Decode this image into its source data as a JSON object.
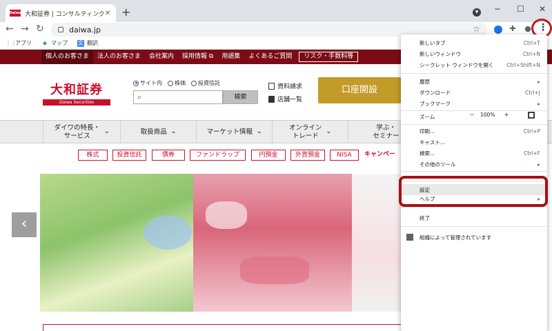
{
  "browser": {
    "tab_title": "大和証券 | コンサルティングとネット取",
    "favicon_text": "Daiwa",
    "tab_close": "✕",
    "new_tab": "+",
    "url": "daiwa.jp",
    "win_min": "−",
    "win_max": "☐",
    "win_close": "✕",
    "bookmarks": [
      {
        "label": "アプリ"
      },
      {
        "label": "マップ"
      },
      {
        "label": "翻訳"
      }
    ]
  },
  "site": {
    "top_nav": [
      "個人のお客さま",
      "法人のお客さま",
      "会社案内",
      "採用情報 ⧉",
      "用語集",
      "よくあるご質問",
      "リスク・手数料等"
    ],
    "logo": {
      "main": "大和証券",
      "sub": "Daiwa Securities"
    },
    "search": {
      "radios": [
        "サイト内",
        "株価",
        "投資信託"
      ],
      "button": "検索"
    },
    "links": [
      "資料請求",
      "店舗一覧"
    ],
    "open_account": "口座開設",
    "main_nav": [
      {
        "line1": "ダイワの特長・",
        "line2": "サービス"
      },
      {
        "line1": "取扱商品",
        "line2": ""
      },
      {
        "line1": "マーケット情報",
        "line2": ""
      },
      {
        "line1": "オンライン",
        "line2": "トレード"
      },
      {
        "line1": "学ぶ・",
        "line2": "セミナー"
      }
    ],
    "categories": [
      "株式",
      "投資信託",
      "債券",
      "ファンドラップ",
      "円預金",
      "外貨預金",
      "NISA",
      "キャンペー"
    ],
    "carousel_prev": "‹",
    "carousel_next": "›"
  },
  "chrome_menu": {
    "items": [
      {
        "label": "新しいタブ",
        "shortcut": "Ctrl+T"
      },
      {
        "label": "新しいウィンドウ",
        "shortcut": "Ctrl+N"
      },
      {
        "label": "シークレット ウィンドウを開く",
        "shortcut": "Ctrl+Shift+N"
      },
      {
        "label": "履歴",
        "shortcut": "▸"
      },
      {
        "label": "ダウンロード",
        "shortcut": "Ctrl+J"
      },
      {
        "label": "ブックマーク",
        "shortcut": "▸"
      },
      {
        "label": "印刷...",
        "shortcut": "Ctrl+P"
      },
      {
        "label": "キャスト...",
        "shortcut": ""
      },
      {
        "label": "検索...",
        "shortcut": "Ctrl+F"
      },
      {
        "label": "その他のツール",
        "shortcut": "▸"
      },
      {
        "label": "設定",
        "shortcut": ""
      },
      {
        "label": "ヘルプ",
        "shortcut": "▸"
      },
      {
        "label": "終了",
        "shortcut": ""
      }
    ],
    "zoom": {
      "label": "ズーム",
      "minus": "−",
      "value": "100%",
      "plus": "+"
    },
    "managed": "組織によって管理されています"
  },
  "colors": {
    "brand_red": "#c8102e",
    "nav_maroon": "#7b0c16",
    "gold": "#c39b28",
    "highlight": "#a50f15"
  }
}
